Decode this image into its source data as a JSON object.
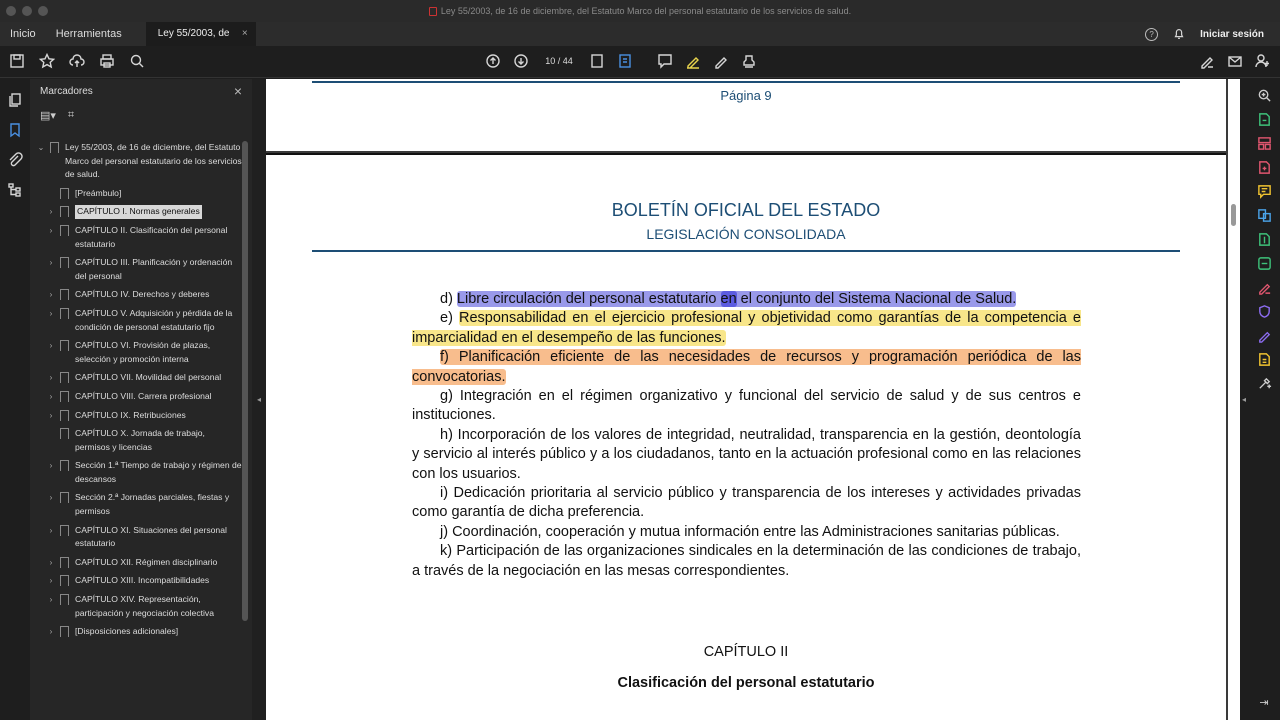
{
  "window": {
    "title": "Ley 55/2003, de 16 de diciembre, del Estatuto Marco del personal estatutario de los servicios de salud."
  },
  "tabs": {
    "home": "Inicio",
    "tools": "Herramientas",
    "document": "Ley 55/2003, de 1...",
    "close": "×",
    "help": "?",
    "sign_in": "Iniciar sesión"
  },
  "toolbar": {
    "current_page": "10",
    "separator": "/",
    "total_pages": "44"
  },
  "bookmarks": {
    "title": "Marcadores",
    "close": "×",
    "items": [
      {
        "label": "Ley 55/2003, de 16 de diciembre, del Estatuto Marco del personal estatutario de los servicios de salud.",
        "chev": "⌄"
      },
      {
        "label": "[Preámbulo]",
        "chev": ""
      },
      {
        "label": "CAPÍTULO I. Normas generales",
        "chev": "›"
      },
      {
        "label": "CAPÍTULO II. Clasificación del personal estatutario",
        "chev": "›"
      },
      {
        "label": "CAPÍTULO III. Planificación y ordenación del personal",
        "chev": "›"
      },
      {
        "label": "CAPÍTULO IV. Derechos y deberes",
        "chev": "›"
      },
      {
        "label": "CAPÍTULO V. Adquisición y pérdida de la condición de personal estatutario fijo",
        "chev": "›"
      },
      {
        "label": "CAPÍTULO VI. Provisión de plazas, selección y promoción interna",
        "chev": "›"
      },
      {
        "label": "CAPÍTULO VII. Movilidad del personal",
        "chev": "›"
      },
      {
        "label": "CAPÍTULO VIII. Carrera profesional",
        "chev": "›"
      },
      {
        "label": "CAPÍTULO IX. Retribuciones",
        "chev": "›"
      },
      {
        "label": "CAPÍTULO X. Jornada de trabajo, permisos y licencias",
        "chev": ""
      },
      {
        "label": "Sección 1.ª Tiempo de trabajo y régimen de descansos",
        "chev": "›"
      },
      {
        "label": "Sección 2.ª Jornadas parciales, fiestas y permisos",
        "chev": "›"
      },
      {
        "label": "CAPÍTULO XI. Situaciones del personal estatutario",
        "chev": "›"
      },
      {
        "label": "CAPÍTULO XII. Régimen disciplinario",
        "chev": "›"
      },
      {
        "label": "CAPÍTULO XIII. Incompatibilidades",
        "chev": "›"
      },
      {
        "label": "CAPÍTULO XIV. Representación, participación y negociación colectiva",
        "chev": "›"
      },
      {
        "label": "[Disposiciones adicionales]",
        "chev": "›"
      }
    ]
  },
  "document": {
    "prev_page_label": "Página 9",
    "header_title": "BOLETÍN OFICIAL DEL ESTADO",
    "header_subtitle": "LEGISLACIÓN CONSOLIDADA",
    "para_d_prefix": "d) ",
    "para_d_part1": "Libre circulación del personal estatutario ",
    "para_d_strong": "en",
    "para_d_part2": " el conjunto del Sistema Nacional de Salud.",
    "para_e_prefix": "e) ",
    "para_e": "Responsabilidad en el ejercicio profesional y objetividad como garantías de la competencia e imparcialidad en el desempeño de las funciones.",
    "para_f": "f) Planificación eficiente de las necesidades de recursos y programación periódica de las convocatorias.",
    "para_g": "g) Integración en el régimen organizativo y funcional del servicio de salud y de sus centros e instituciones.",
    "para_h": "h) Incorporación de los valores de integridad, neutralidad, transparencia en la gestión, deontología y servicio al interés público y a los ciudadanos, tanto en la actuación profesional como en las relaciones con los usuarios.",
    "para_i": "i) Dedicación prioritaria al servicio público y transparencia de los intereses y actividades privadas como garantía de dicha preferencia.",
    "para_j": "j) Coordinación, cooperación y mutua información entre las Administraciones sanitarias públicas.",
    "para_k": "k) Participación de las organizaciones sindicales en la determinación de las condiciones de trabajo, a través de la negociación en las mesas correspondientes.",
    "chapter": "CAPÍTULO II",
    "chapter_title": "Clasificación del personal estatutario"
  },
  "colors": {
    "highlight_blue": "#9999ea",
    "highlight_yellow": "#f8e68a",
    "highlight_orange": "#f8bd8d",
    "boe_blue": "#1d4e75"
  }
}
